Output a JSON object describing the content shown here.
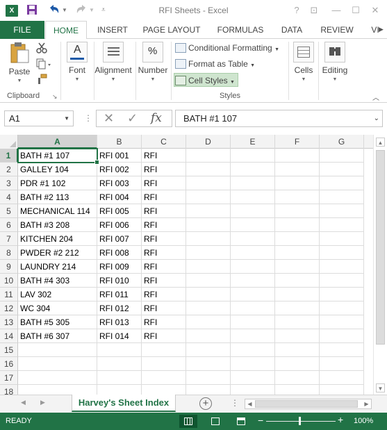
{
  "window": {
    "title": "RFI Sheets - Excel",
    "help": "?",
    "restore_ribbon": "⊡",
    "minimize": "—",
    "maximize": "☐",
    "close": "✕"
  },
  "quick_access": {
    "app_icon": "X",
    "save_icon": "save-icon",
    "undo_icon": "undo-icon",
    "redo_icon": "redo-icon",
    "customize_icon": "customize-icon"
  },
  "ribbon_tabs": [
    "FILE",
    "HOME",
    "INSERT",
    "PAGE LAYOUT",
    "FORMULAS",
    "DATA",
    "REVIEW",
    "VI"
  ],
  "active_tab": "HOME",
  "ribbon": {
    "clipboard": {
      "paste": "Paste",
      "label": "Clipboard"
    },
    "font": "Font",
    "alignment": "Alignment",
    "number": "Number",
    "styles": {
      "conditional_formatting": "Conditional Formatting",
      "format_as_table": "Format as Table",
      "cell_styles": "Cell Styles",
      "label": "Styles"
    },
    "cells": "Cells",
    "editing": "Editing"
  },
  "formula_bar": {
    "name_box": "A1",
    "fx": "fx",
    "value": "BATH #1 107"
  },
  "grid": {
    "columns": [
      "A",
      "B",
      "C",
      "D",
      "E",
      "F",
      "G"
    ],
    "row_numbers": [
      "1",
      "2",
      "3",
      "4",
      "5",
      "6",
      "7",
      "8",
      "9",
      "10",
      "11",
      "12",
      "13",
      "14",
      "15",
      "16",
      "17",
      "18"
    ],
    "rows": [
      [
        "BATH #1 107",
        "RFI 001",
        "RFI"
      ],
      [
        "GALLEY 104",
        "RFI 002",
        "RFI"
      ],
      [
        "PDR #1 102",
        "RFI 003",
        "RFI"
      ],
      [
        "BATH #2 113",
        "RFI 004",
        "RFI"
      ],
      [
        "MECHANICAL 114",
        "RFI 005",
        "RFI"
      ],
      [
        "BATH #3 208",
        "RFI 006",
        "RFI"
      ],
      [
        "KITCHEN 204",
        "RFI 007",
        "RFI"
      ],
      [
        "PWDER #2 212",
        "RFI 008",
        "RFI"
      ],
      [
        "LAUNDRY 214",
        "RFI 009",
        "RFI"
      ],
      [
        "BATH #4 303",
        "RFI 010",
        "RFI"
      ],
      [
        "LAV 302",
        "RFI 011",
        "RFI"
      ],
      [
        "WC 304",
        "RFI 012",
        "RFI"
      ],
      [
        "BATH #5 305",
        "RFI 013",
        "RFI"
      ],
      [
        "BATH #6 307",
        "RFI 014",
        "RFI"
      ]
    ],
    "active_cell": "A1"
  },
  "sheets": {
    "tabs": [
      "Harvey's Sheet Index"
    ],
    "active": "Harvey's Sheet Index"
  },
  "status": {
    "ready": "READY",
    "zoom": "100%",
    "zoom_minus": "−",
    "zoom_plus": "+"
  },
  "colors": {
    "accent": "#217346",
    "selected_header_bg": "#d2d2d2",
    "cell_styles_highlight": "#cfe5cf"
  }
}
